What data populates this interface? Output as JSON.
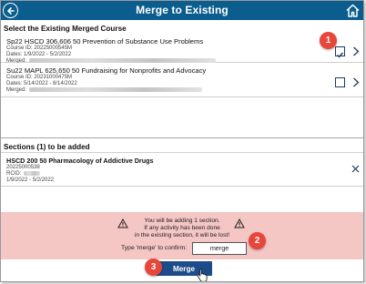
{
  "header": {
    "title": "Merge to Existing",
    "back_icon": "back-arrow-icon",
    "home_icon": "home-icon",
    "color": "#0a5d8c"
  },
  "existing": {
    "label": "Select the Existing Merged Course",
    "courses": [
      {
        "name": "Sp22 HSCD 306,606 50 Prevention of Substance Use Problems",
        "course_id": "Course ID: 20225000545M",
        "dates": "Dates: 1/9/2022 - 5/2/2022",
        "merged": "Merged:",
        "checked": true
      },
      {
        "name": "Su22 MAPL 625,650 50 Fundraising for Nonprofits and Advocacy",
        "course_id": "Course ID: 20231000475M",
        "dates": "Dates: 5/14/2022 - 8/14/2022",
        "merged": "Merged:",
        "checked": false
      }
    ]
  },
  "to_add": {
    "label": "Sections (1) to be added",
    "sections": [
      {
        "name": "HSCD 200 50 Pharmacology of Addictive Drugs",
        "code": "20225000538",
        "rcid": "RCID:",
        "dates": "1/9/2022 - 5/2/2022"
      }
    ]
  },
  "warning": {
    "line1": "You will be adding 1 section.",
    "line2": "If any activity has been done",
    "line3": "in the existing section, it will be lost!",
    "confirm_label": "Type 'merge' to confirm:",
    "confirm_value": "merge",
    "background": "#f4c6c4"
  },
  "merge_button": {
    "label": "Merge",
    "color": "#1d4c8a"
  },
  "callouts": [
    "1",
    "2",
    "3"
  ]
}
